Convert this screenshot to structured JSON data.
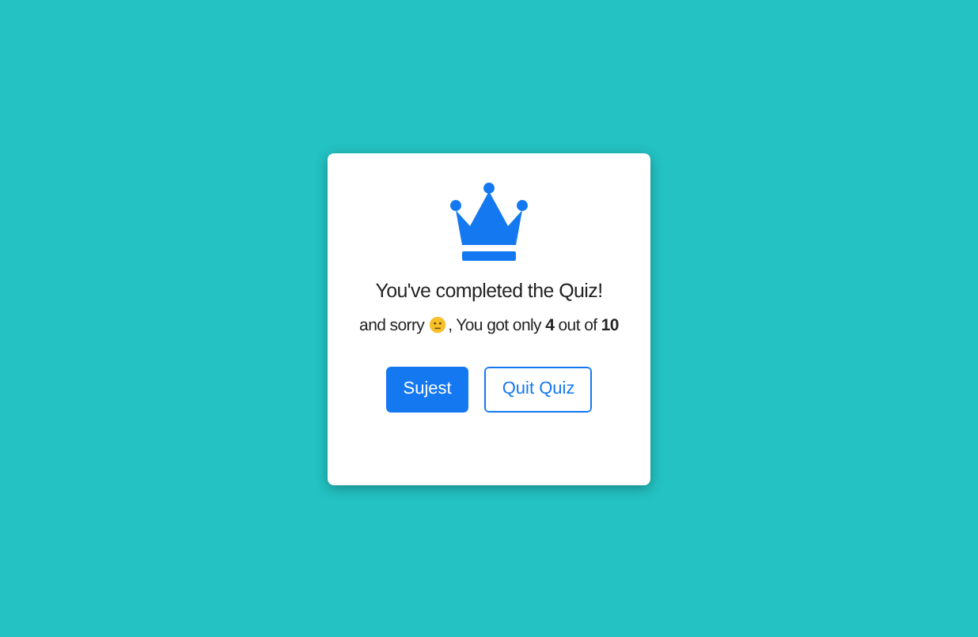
{
  "result_card": {
    "title": "You've completed the Quiz!",
    "message_before_icon": "and sorry",
    "message_after_icon": ", You got only **4** out of **10**",
    "buttons": [
      {
        "label": "Sujest",
        "kind": "primary"
      },
      {
        "label": "Quit Quiz",
        "kind": "outline"
      }
    ]
  }
}
